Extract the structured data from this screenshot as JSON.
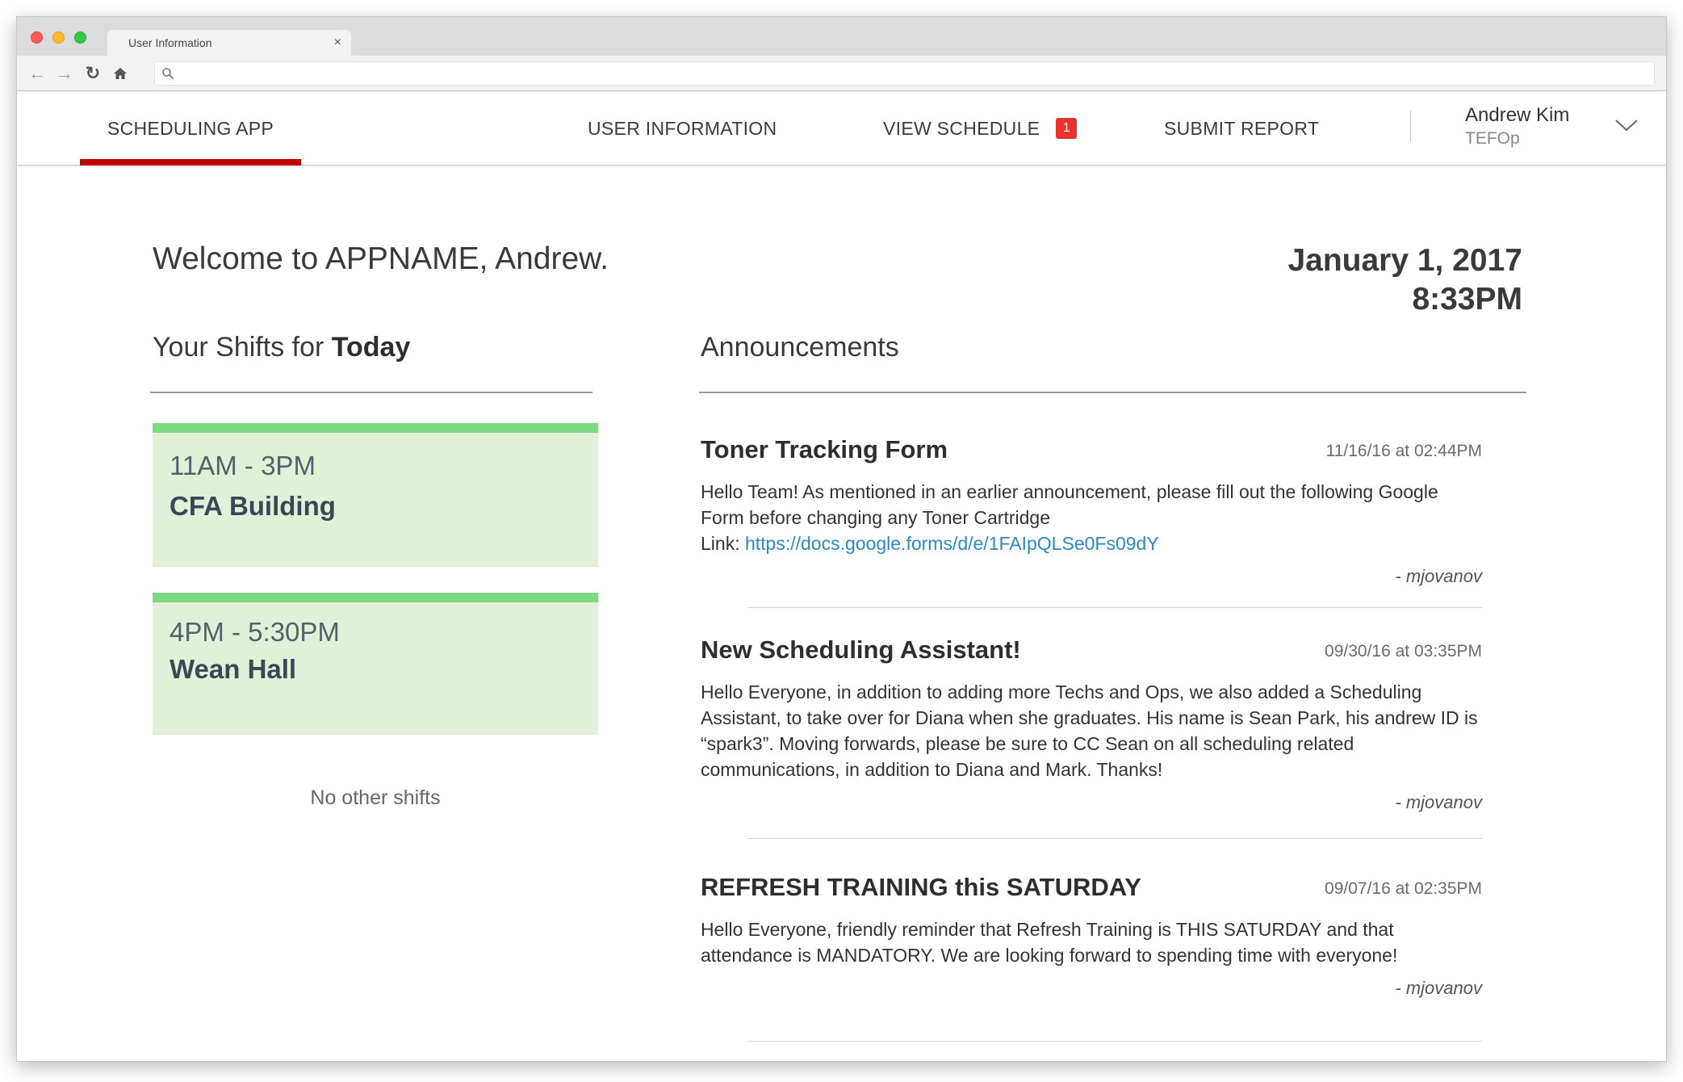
{
  "browser": {
    "tab_title": "User Information",
    "tab_close": "×"
  },
  "navbar": {
    "brand": "SCHEDULING APP",
    "items": [
      {
        "label": "USER INFORMATION"
      },
      {
        "label": "VIEW SCHEDULE",
        "badge": "1"
      },
      {
        "label": "SUBMIT REPORT"
      }
    ],
    "user": {
      "name": "Andrew Kim",
      "role": "TEFOp"
    }
  },
  "main": {
    "welcome": "Welcome to APPNAME, Andrew.",
    "date": "January 1, 2017",
    "time": "8:33PM",
    "shifts": {
      "title_prefix": "Your Shifts for ",
      "title_bold": "Today",
      "items": [
        {
          "time": "11AM - 3PM",
          "location": "CFA Building"
        },
        {
          "time": "4PM - 5:30PM",
          "location": "Wean Hall"
        }
      ],
      "empty_text": "No other shifts"
    },
    "announcements": {
      "title": "Announcements",
      "items": [
        {
          "title": "Toner Tracking Form",
          "date": "11/16/16 at 02:44PM",
          "body": "Hello Team! As mentioned in an earlier announcement, please fill out the following Google Form before changing any Toner Cartridge",
          "link_label": "Link: ",
          "link": "https://docs.google.forms/d/e/1FAIpQLSe0Fs09dY",
          "author": "- mjovanov"
        },
        {
          "title": "New Scheduling Assistant!",
          "date": "09/30/16 at 03:35PM",
          "body": "Hello Everyone, in addition to adding more Techs and Ops, we also added a Scheduling Assistant, to take over for Diana when she graduates. His name is Sean Park, his andrew ID is “spark3”. Moving forwards, please be sure to CC Sean on all scheduling related communications, in addition to Diana and Mark. Thanks!",
          "author": "- mjovanov"
        },
        {
          "title": "REFRESH TRAINING this SATURDAY",
          "date": "09/07/16 at 02:35PM",
          "body": "Hello Everyone, friendly reminder that Refresh Training is THIS SATURDAY and that attendance is MANDATORY. We are looking forward to spending time with everyone!",
          "author": "- mjovanov"
        }
      ]
    }
  },
  "colors": {
    "accent": "#c00000",
    "badge": "#e8322c",
    "shift_bg": "#e2f0d9",
    "shift_bar": "#7dd882",
    "link": "#2a8ac2"
  }
}
